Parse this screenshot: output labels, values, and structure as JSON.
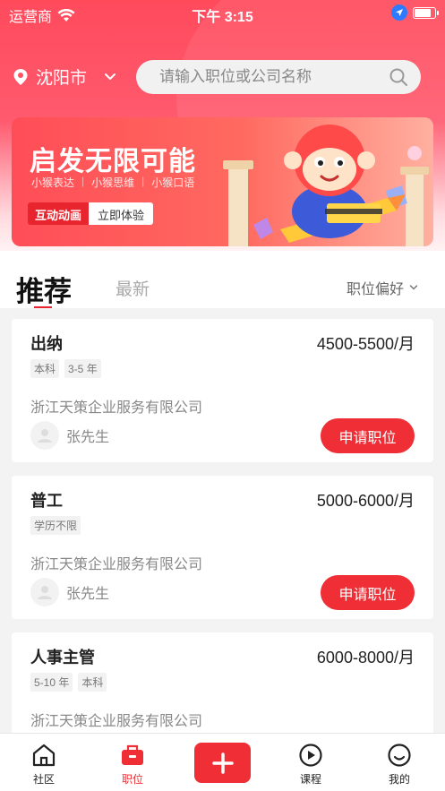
{
  "status_bar": {
    "carrier": "运营商",
    "time": "下午 3:15"
  },
  "header": {
    "city": "沈阳市",
    "search_placeholder": "请输入职位或公司名称"
  },
  "banner": {
    "title": "启发无限可能",
    "subtitles": [
      "小猴表达",
      "小猴思维",
      "小猴口语"
    ],
    "tag": "互动动画",
    "cta": "立即体验"
  },
  "tabs": {
    "recommended": "推荐",
    "latest": "最新",
    "preference": "职位偏好"
  },
  "jobs": [
    {
      "title": "出纳",
      "salary": "4500-5500/月",
      "tags": [
        "本科",
        "3-5 年"
      ],
      "company": "浙江天策企业服务有限公司",
      "contact": "张先生",
      "apply": "申请职位"
    },
    {
      "title": "普工",
      "salary": "5000-6000/月",
      "tags": [
        "学历不限"
      ],
      "company": "浙江天策企业服务有限公司",
      "contact": "张先生",
      "apply": "申请职位"
    },
    {
      "title": "人事主管",
      "salary": "6000-8000/月",
      "tags": [
        "5-10 年",
        "本科"
      ],
      "company": "浙江天策企业服务有限公司",
      "contact": "",
      "apply": ""
    }
  ],
  "tabbar": {
    "items": [
      {
        "label": "社区",
        "icon": "home-icon"
      },
      {
        "label": "职位",
        "icon": "briefcase-icon"
      },
      {
        "label": "",
        "icon": "plus-icon"
      },
      {
        "label": "课程",
        "icon": "play-icon"
      },
      {
        "label": "我的",
        "icon": "smile-icon"
      }
    ],
    "active": "职位"
  },
  "colors": {
    "accent": "#ef2e35",
    "header_red": "#ff4a5c"
  }
}
